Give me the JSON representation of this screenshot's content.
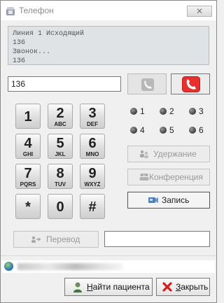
{
  "window": {
    "title": "Телефон",
    "close_symbol": "✕"
  },
  "log": {
    "lines": [
      "Линия 1 Исходящий",
      "136",
      "Звонок...",
      "136"
    ]
  },
  "dial": {
    "number": "136"
  },
  "icons": {
    "call": "phone-icon",
    "hangup": "hangup-phone-icon",
    "hold": "people-hold-icon",
    "conference": "people-conference-icon",
    "record": "recorder-icon",
    "transfer": "transfer-icon",
    "status": "globe-icon",
    "find": "person-icon",
    "close": "red-x-icon"
  },
  "colors": {
    "hangup": "#e8302e",
    "close_icon": "#d02020"
  },
  "keypad": [
    {
      "digit": "1",
      "letters": ""
    },
    {
      "digit": "2",
      "letters": "ABC"
    },
    {
      "digit": "3",
      "letters": "DEF"
    },
    {
      "digit": "4",
      "letters": "GHI"
    },
    {
      "digit": "5",
      "letters": "JKL"
    },
    {
      "digit": "6",
      "letters": "MNO"
    },
    {
      "digit": "7",
      "letters": "PQRS"
    },
    {
      "digit": "8",
      "letters": "TUV"
    },
    {
      "digit": "9",
      "letters": "WXYZ"
    },
    {
      "digit": "*",
      "letters": ""
    },
    {
      "digit": "0",
      "letters": ""
    },
    {
      "digit": "#",
      "letters": ""
    }
  ],
  "lines": [
    "1",
    "2",
    "3",
    "4",
    "5",
    "6"
  ],
  "actions": {
    "hold": "Удержание",
    "conference": "Конференция",
    "record": "Запись",
    "transfer": "Перевод"
  },
  "bottom": {
    "find_patient_key": "Н",
    "find_patient_rest": "айти пациента",
    "close_key": "З",
    "close_rest": "акрыть"
  }
}
